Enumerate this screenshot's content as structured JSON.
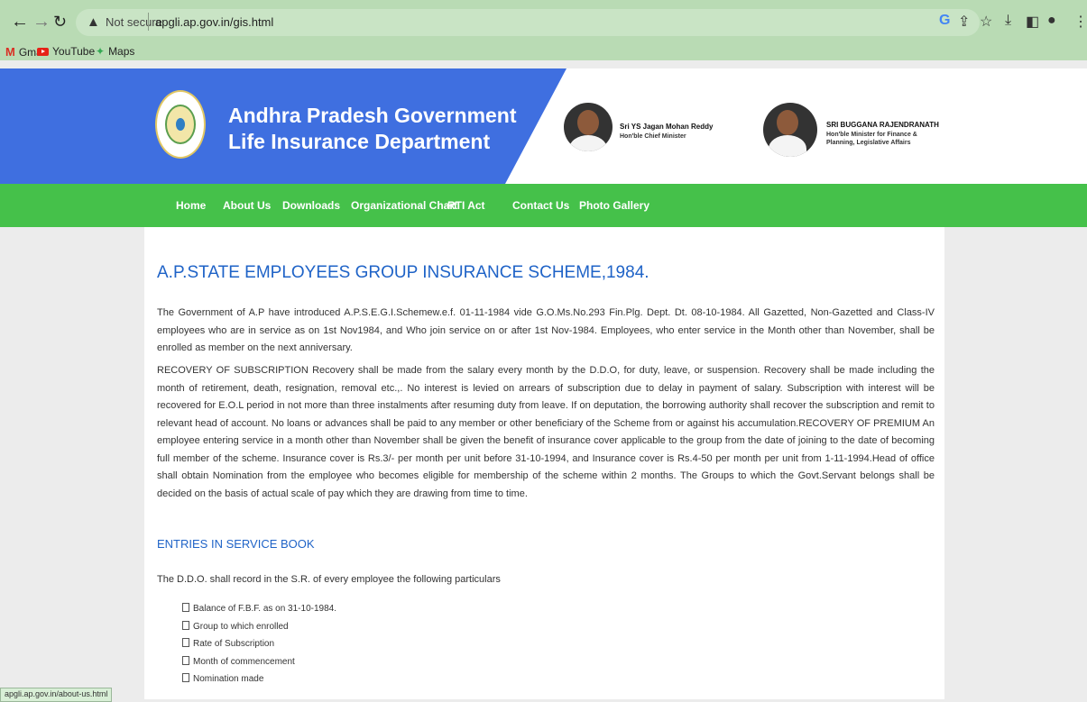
{
  "browser": {
    "not_secure_label": "Not secure",
    "url": "apgli.ap.gov.in/gis.html",
    "bookmarks": [
      {
        "label": "Gmail"
      },
      {
        "label": "YouTube"
      },
      {
        "label": "Maps"
      }
    ],
    "status_url": "apgli.ap.gov.in/about-us.html"
  },
  "header": {
    "title_line1": "Andhra Pradesh Government",
    "title_line2": "Life Insurance Department",
    "person1": {
      "name": "Sri YS Jagan Mohan Reddy",
      "role": "Hon'ble Chief Minister"
    },
    "person2": {
      "name": "SRI BUGGANA RAJENDRANATH",
      "role_line1": "Hon'ble Minister for Finance &",
      "role_line2": "Planning, Legislative Affairs"
    }
  },
  "nav": {
    "items": [
      "Home",
      "About Us",
      "Downloads",
      "Organizational Chart",
      "RTI Act",
      "Contact Us",
      "Photo Gallery"
    ]
  },
  "content": {
    "title": "A.P.STATE EMPLOYEES GROUP INSURANCE SCHEME,1984.",
    "para1": "The Government of A.P have introduced A.P.S.E.G.I.Schemew.e.f. 01-11-1984 vide G.O.Ms.No.293 Fin.Plg. Dept. Dt. 08-10-1984. All Gazetted, Non-Gazetted and Class-IV employees who are in service as on 1st Nov1984, and Who join service on or after 1st Nov-1984. Employees, who enter service in the Month other than November, shall be enrolled as member on the next anniversary.",
    "para2": "RECOVERY OF SUBSCRIPTION Recovery shall be made from the salary every month by the D.D.O, for duty, leave, or suspension. Recovery shall be made including the month of retirement, death, resignation, removal etc.,. No interest is levied on arrears of subscription due to delay in payment of salary. Subscription with interest will be recovered for E.O.L period in not more than three instalments after resuming duty from leave. If on deputation, the borrowing authority shall recover the subscription and remit to relevant head of account. No loans or advances shall be paid to any member or other beneficiary of the Scheme from or against his accumulation.RECOVERY OF PREMIUM An employee entering service in a month other than November shall be given the benefit of insurance cover applicable to the group from the date of joining to the date of becoming full member of the scheme. Insurance cover is Rs.3/- per month per unit before 31-10-1994, and Insurance cover is Rs.4-50 per month per unit from 1-11-1994.Head of office shall obtain Nomination from the employee who becomes eligible for membership of the scheme within 2 months. The Groups to which the Govt.Servant belongs shall be decided on the basis of actual scale of pay which they are drawing from time to time.",
    "entries_heading": "ENTRIES IN SERVICE BOOK",
    "entries_intro": "The D.D.O. shall record in the S.R. of every employee the following particulars",
    "entries": [
      "Balance of F.B.F. as on 31-10-1984.",
      "Group to which enrolled",
      "Rate of Subscription",
      "Month of commencement",
      "Nomination made"
    ]
  }
}
